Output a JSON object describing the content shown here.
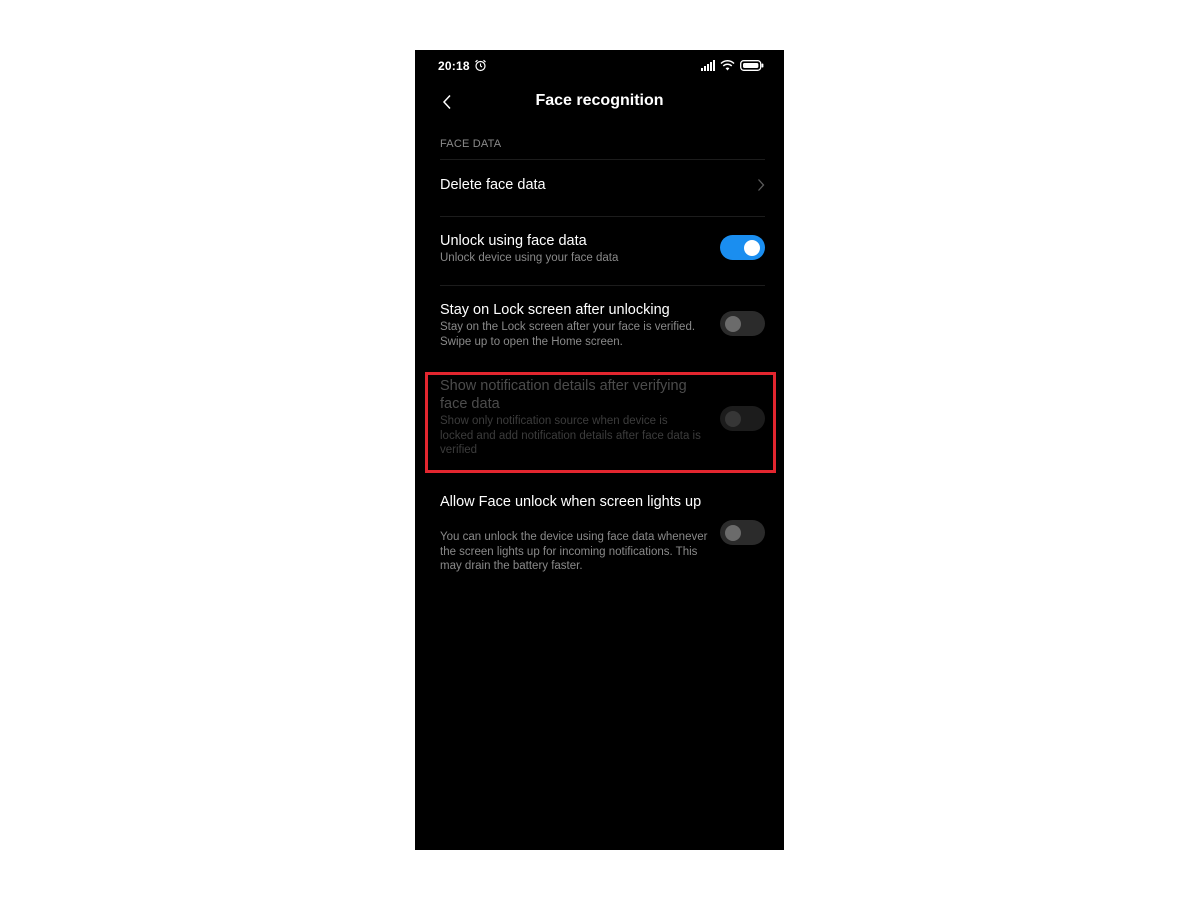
{
  "status_bar": {
    "time": "20:18"
  },
  "header": {
    "title": "Face recognition"
  },
  "section": {
    "label": "FACE DATA"
  },
  "rows": [
    {
      "title": "Delete face data"
    },
    {
      "title": "Unlock using face data",
      "description": "Unlock device using your face data",
      "toggle": "on"
    },
    {
      "title": "Stay on Lock screen after unlocking",
      "description": "Stay on the Lock screen after your face is verified. Swipe up to open the Home screen.",
      "toggle": "off"
    },
    {
      "title": "Show notification details after verifying face data",
      "description": "Show only notification source when device is locked and add notification details after face data is verified",
      "toggle": "off",
      "state": "disabled",
      "highlighted": true
    },
    {
      "title": "Allow Face unlock when screen lights up",
      "description": "You can unlock the device using face data whenever the screen lights up for incoming notifications. This may drain the battery faster.",
      "toggle": "off"
    }
  ],
  "colors": {
    "accent": "#1a8ef0",
    "highlight": "#e3262f",
    "background": "#000000"
  }
}
